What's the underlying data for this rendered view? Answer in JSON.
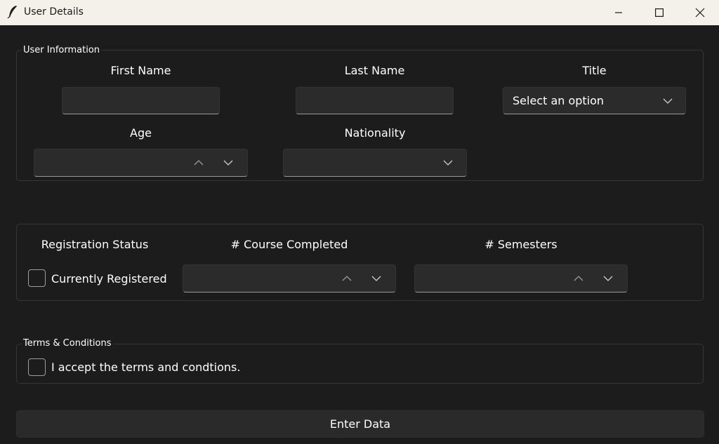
{
  "window": {
    "title": "User Details",
    "minimize_icon": "minimize-icon",
    "maximize_icon": "maximize-icon",
    "close_icon": "close-icon"
  },
  "user_info": {
    "group_label": "User Information",
    "first_name": {
      "label": "First Name",
      "value": ""
    },
    "last_name": {
      "label": "Last Name",
      "value": ""
    },
    "title": {
      "label": "Title",
      "value": "Select an option"
    },
    "age": {
      "label": "Age",
      "value": ""
    },
    "nationality": {
      "label": "Nationality",
      "value": ""
    }
  },
  "registration": {
    "status_label": "Registration Status",
    "checkbox_label": "Currently Registered",
    "checked": false,
    "courses_label": "# Course Completed",
    "courses_value": "",
    "semesters_label": "# Semesters",
    "semesters_value": ""
  },
  "terms": {
    "group_label": "Terms & Conditions",
    "checkbox_label": "I accept the terms and condtions.",
    "checked": false
  },
  "actions": {
    "enter_label": "Enter Data"
  },
  "colors": {
    "background": "#1c1c1c",
    "titlebar": "#f3f1ea",
    "input_bg": "#2b2b2b",
    "button_bg": "#2a2a2a"
  }
}
